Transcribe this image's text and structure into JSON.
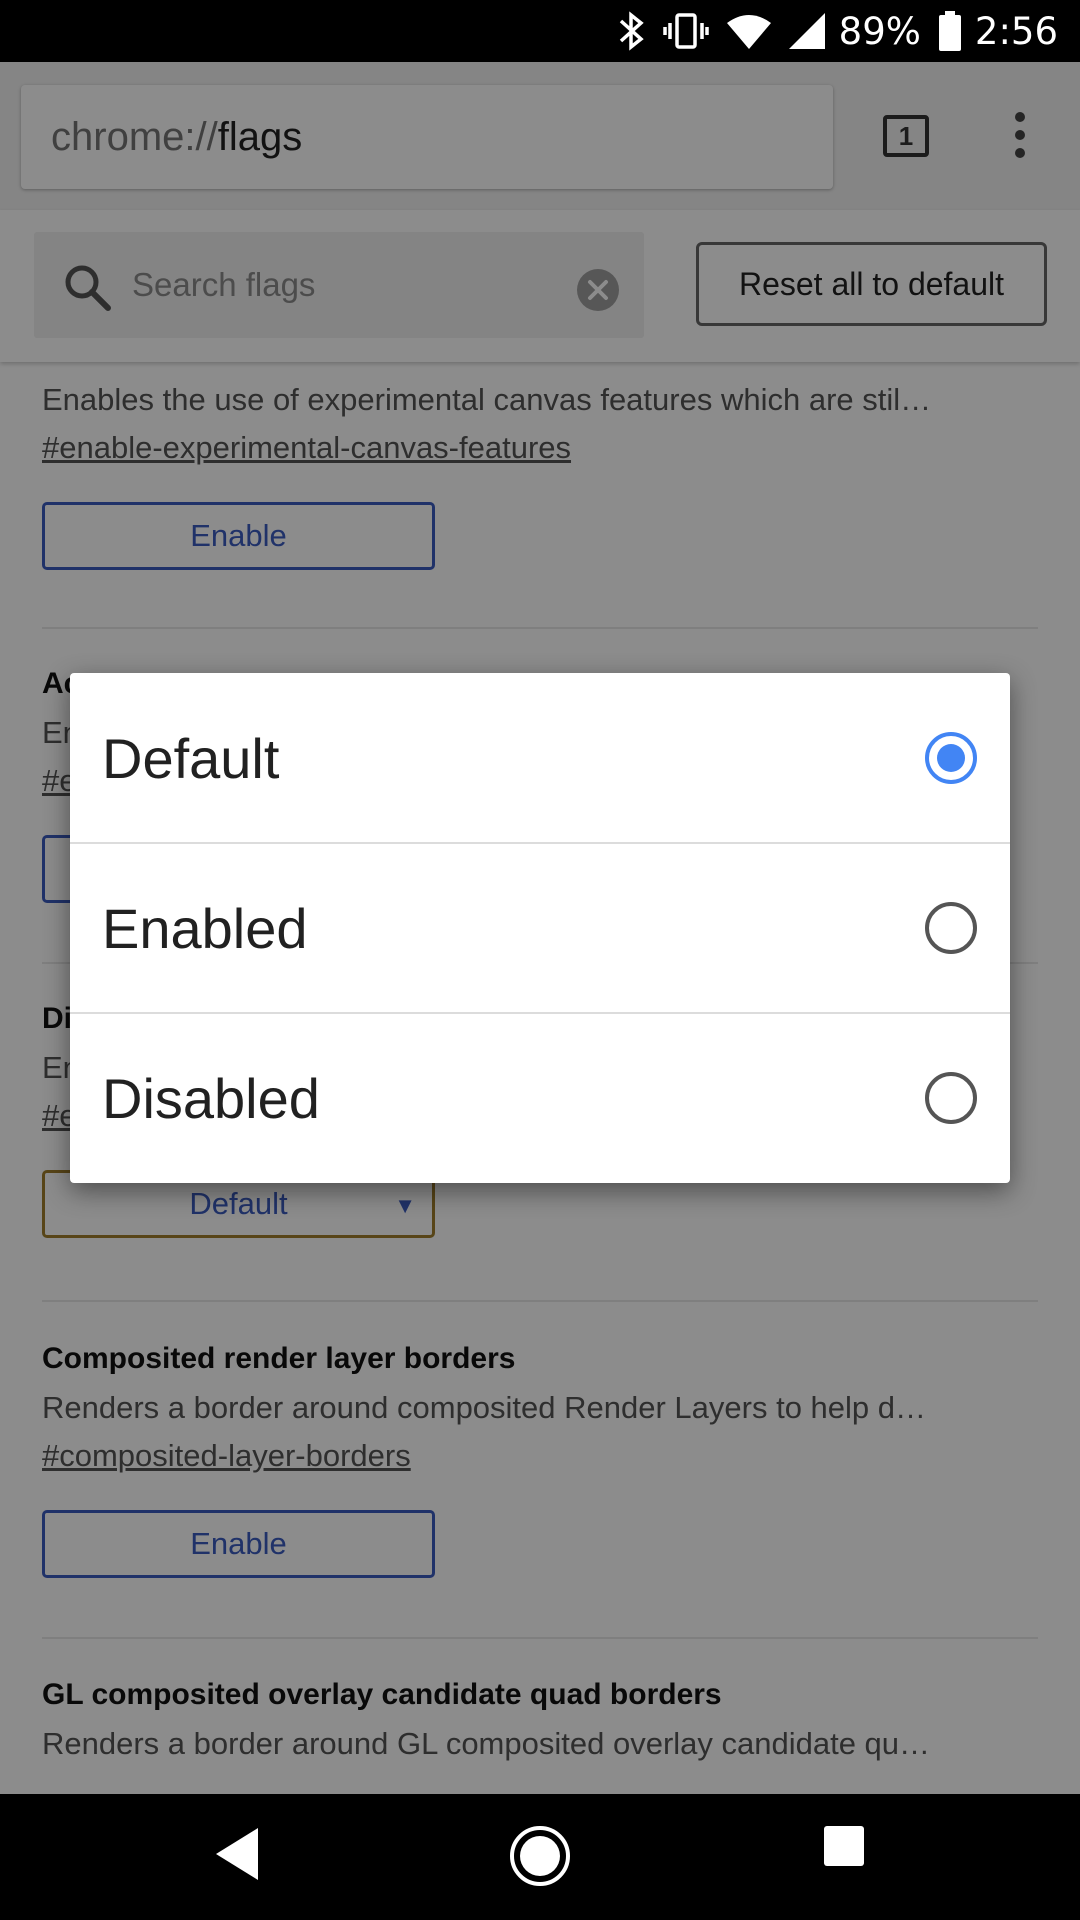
{
  "status_bar": {
    "battery": "89%",
    "time": "2:56"
  },
  "toolbar": {
    "url_scheme": "chrome://",
    "url_path": "flags",
    "tab_count": "1"
  },
  "flags_header": {
    "search_placeholder": "Search flags",
    "reset_label": "Reset all to default"
  },
  "flags": [
    {
      "title": "",
      "description": "Enables the use of experimental canvas features which are stil…",
      "link": "#enable-experimental-canvas-features",
      "control": "Enable"
    },
    {
      "title": "Ac",
      "description": "En",
      "link": "#e",
      "control": ""
    },
    {
      "title": "Di",
      "description": "En",
      "link": "#e",
      "control": "Default"
    },
    {
      "title": "Composited render layer borders",
      "description": "Renders a border around composited Render Layers to help d…",
      "link": "#composited-layer-borders",
      "control": "Enable"
    },
    {
      "title": "GL composited overlay candidate quad borders",
      "description": "Renders a border around GL composited overlay candidate qu…",
      "link": "",
      "control": ""
    }
  ],
  "dialog": {
    "options": [
      {
        "label": "Default",
        "selected": true
      },
      {
        "label": "Enabled",
        "selected": false
      },
      {
        "label": "Disabled",
        "selected": false
      }
    ]
  },
  "colors": {
    "accent": "#4285f4",
    "link_blue": "#3b5bbf",
    "scrim": "#000000"
  },
  "icons": {
    "status": [
      "bluetooth-icon",
      "vibrate-icon",
      "wifi-icon",
      "signal-icon",
      "battery-icon"
    ],
    "nav": [
      "back-icon",
      "home-icon",
      "recents-icon"
    ]
  }
}
